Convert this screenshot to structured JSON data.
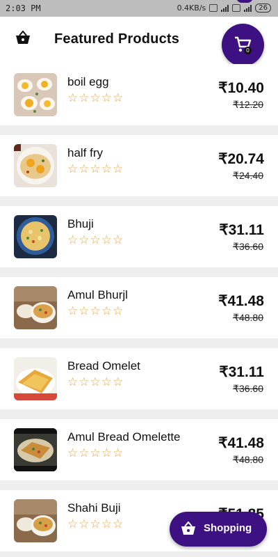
{
  "status_bar": {
    "time": "2:03 PM",
    "network_speed": "0.4KB/s",
    "battery": "26"
  },
  "header": {
    "title": "Featured Products",
    "basket_icon": "shopping-basket-icon",
    "cart_icon": "cart-icon",
    "cart_count": "0"
  },
  "products": [
    {
      "name": "boil egg",
      "price": "₹10.40",
      "old_price": "₹12.20",
      "rating": 0,
      "max_rating": 5
    },
    {
      "name": "half fry",
      "price": "₹20.74",
      "old_price": "₹24.40",
      "rating": 0,
      "max_rating": 5
    },
    {
      "name": "Bhuji",
      "price": "₹31.11",
      "old_price": "₹36.60",
      "rating": 0,
      "max_rating": 5
    },
    {
      "name": "Amul Bhurjl",
      "price": "₹41.48",
      "old_price": "₹48.80",
      "rating": 0,
      "max_rating": 5
    },
    {
      "name": "Bread Omelet",
      "price": "₹31.11",
      "old_price": "₹36.60",
      "rating": 0,
      "max_rating": 5
    },
    {
      "name": "Amul Bread Omelette",
      "price": "₹41.48",
      "old_price": "₹48.80",
      "rating": 0,
      "max_rating": 5
    },
    {
      "name": "Shahi Buji",
      "price": "₹51.85",
      "old_price": "",
      "rating": 0,
      "max_rating": 5
    }
  ],
  "shopping_button": {
    "label": "Shopping",
    "icon": "shopping-basket-icon"
  },
  "colors": {
    "accent": "#3d1182",
    "star": "#e8a33a",
    "card": "#ffffff",
    "background": "#eeeeee"
  }
}
